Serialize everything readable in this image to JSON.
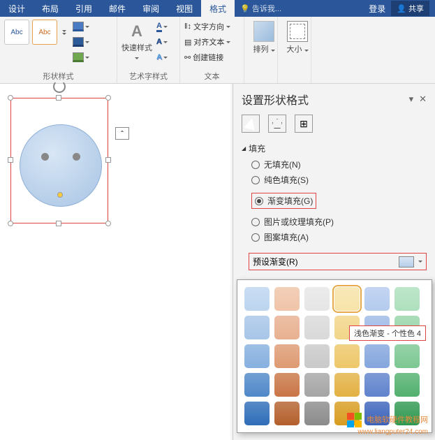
{
  "tabs": {
    "design": "设计",
    "layout": "布局",
    "references": "引用",
    "mailings": "邮件",
    "review": "审阅",
    "view": "视图",
    "format": "格式",
    "tell": "告诉我...",
    "signin": "登录",
    "share": "共享"
  },
  "groups": {
    "shape_styles": "形状样式",
    "wordart_styles": "艺术字样式",
    "text": "文本",
    "quick_styles": "快速样式",
    "arrange": "排列",
    "size": "大小",
    "text_dir": "文字方向",
    "align_text": "对齐文本",
    "create_link": "创建链接",
    "abc": "Abc",
    "A": "A"
  },
  "pane": {
    "title": "设置形状格式",
    "section_fill": "填充",
    "no_fill": "无填充(N)",
    "solid": "纯色填充(S)",
    "gradient": "渐变填充(G)",
    "picture": "图片或纹理填充(P)",
    "pattern": "图案填充(A)",
    "preset": "预设渐变(R)"
  },
  "tooltip": "浅色渐变 - 个性色 4",
  "watermark": {
    "text": "电脑软硬件教程网",
    "url": "www.liangputer24.com"
  },
  "gradient_colors": [
    [
      "#bcd5f0",
      "#f0c4a8",
      "#e6e6e6",
      "#f7e3a8",
      "#b4cbee",
      "#aee0bd"
    ],
    [
      "#a7c5e8",
      "#e8b090",
      "#d9d9d9",
      "#f2d589",
      "#9db9e6",
      "#96d4a8"
    ],
    [
      "#86b0df",
      "#de9a72",
      "#c9c9c9",
      "#edc768",
      "#84a6dd",
      "#7cc792"
    ],
    [
      "#4f88c9",
      "#c97545",
      "#a5a5a5",
      "#e3b142",
      "#5e82cc",
      "#52b06e"
    ],
    [
      "#2e6db8",
      "#b45f2c",
      "#8b8b8b",
      "#d89c1f",
      "#3b63bb",
      "#2e9850"
    ]
  ]
}
